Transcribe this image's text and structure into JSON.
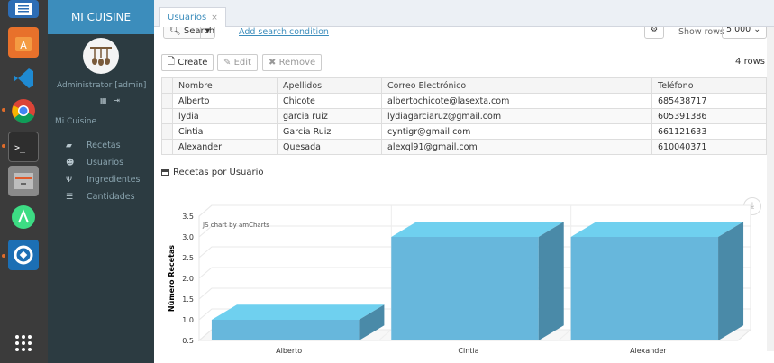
{
  "sidebar": {
    "brand": "MI CUISINE",
    "user": "Administrator [admin]",
    "section": "Mi Cuisine",
    "items": [
      {
        "label": "Recetas",
        "icon": "book-icon"
      },
      {
        "label": "Usuarios",
        "icon": "users-icon"
      },
      {
        "label": "Ingredientes",
        "icon": "cutlery-icon"
      },
      {
        "label": "Cantidades",
        "icon": "list-icon"
      }
    ]
  },
  "tab": {
    "label": "Usuarios",
    "close": "×"
  },
  "search": {
    "button_label": "Search",
    "add_condition": "Add search condition",
    "show_rows_label": "Show rows",
    "show_rows_value": "5,000"
  },
  "toolbar": {
    "create": "Create",
    "edit": "Edit",
    "remove": "Remove",
    "row_count": "4 rows"
  },
  "table": {
    "columns": [
      "Nombre",
      "Apellidos",
      "Correo Electrónico",
      "Teléfono"
    ],
    "rows": [
      [
        "Alberto",
        "Chicote",
        "albertochicote@lasexta.com",
        "685438717"
      ],
      [
        "lydia",
        "garcia ruiz",
        "lydiagarciaruz@gmail.com",
        "605391386"
      ],
      [
        "Cintia",
        "Garcia Ruiz",
        "cyntigr@gmail.com",
        "661121633"
      ],
      [
        "Alexander",
        "Quesada",
        "alexql91@gmail.com",
        "610040371"
      ]
    ]
  },
  "chart_section_title": "Recetas por Usuario",
  "chart_data": {
    "type": "bar",
    "categories": [
      "Alberto",
      "Cintia",
      "Alexander"
    ],
    "values": [
      1,
      3,
      3
    ],
    "ylabel": "Número Recetas",
    "ylim": [
      0.5,
      3.5
    ],
    "yticks": [
      "0.5",
      "1.0",
      "1.5",
      "2.0",
      "2.5",
      "3.0",
      "3.5"
    ],
    "credit": "JS chart by amCharts",
    "bar_color": "#67b7dc",
    "grid": true
  }
}
